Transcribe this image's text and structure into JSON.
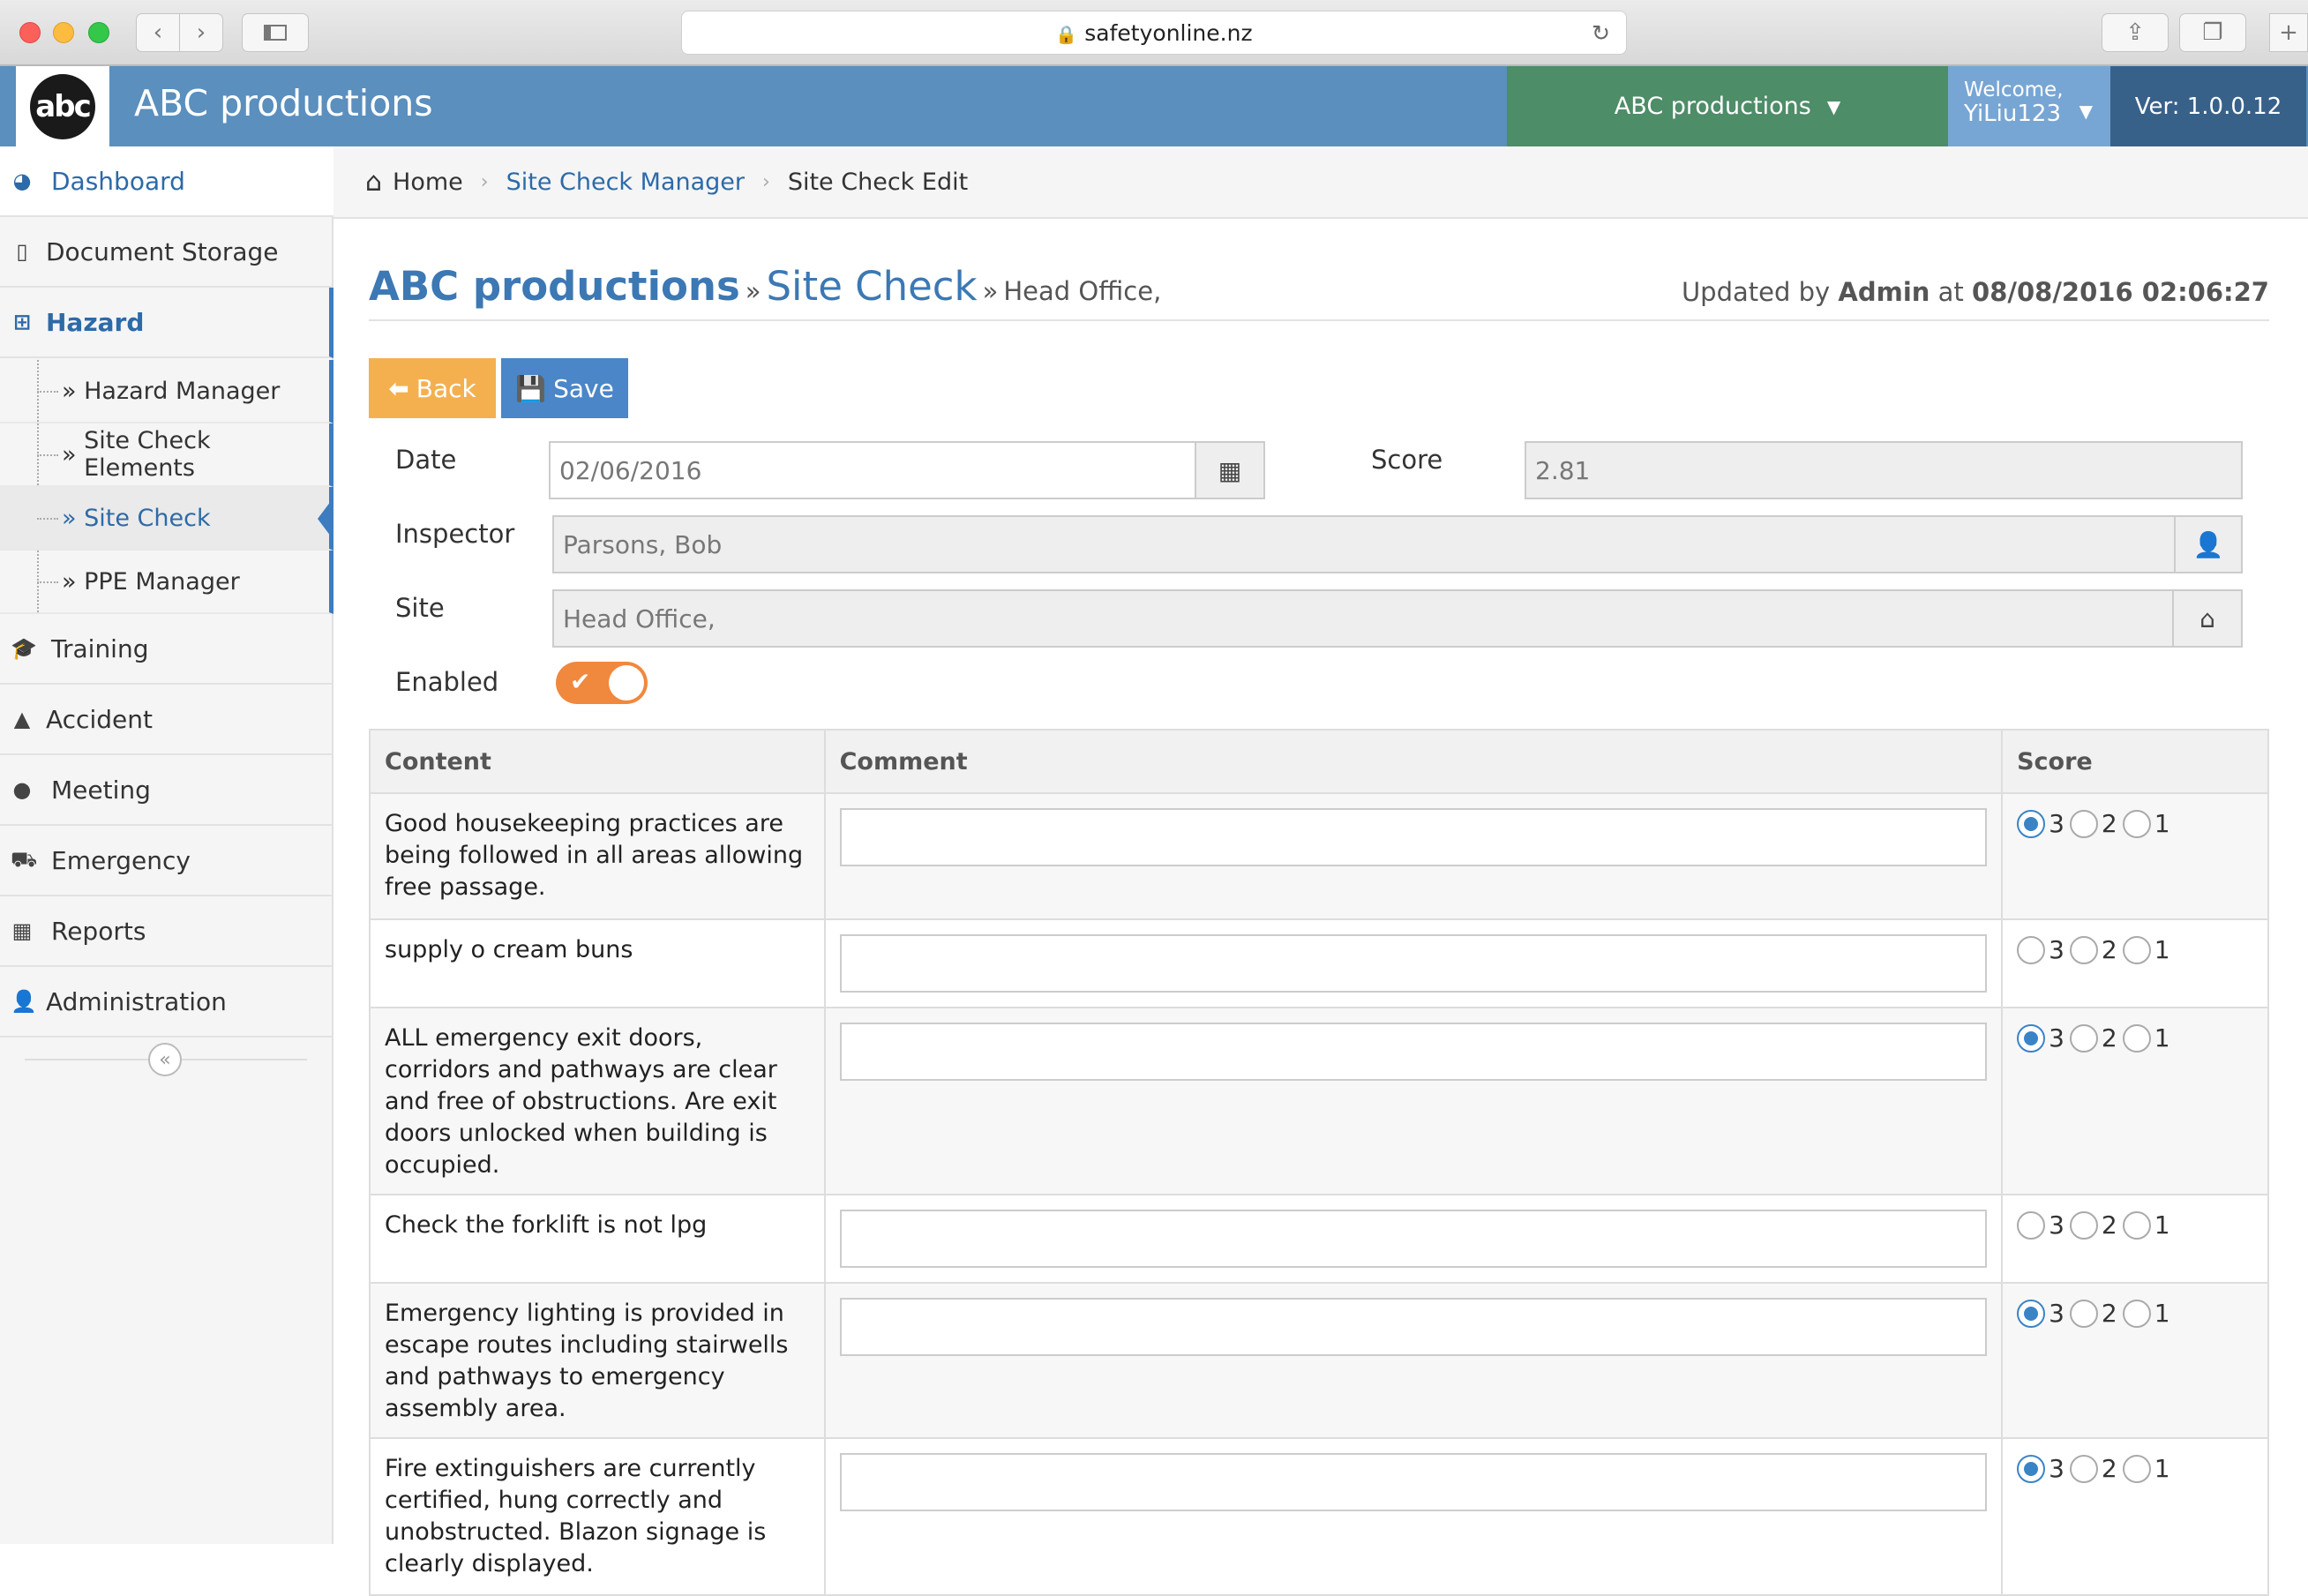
{
  "browser": {
    "url": "safetyonline.nz"
  },
  "app": {
    "title": "ABC productions",
    "logo_text": "abc",
    "org_selector": "ABC productions",
    "welcome": "Welcome,",
    "user": "YiLiu123",
    "version": "Ver: 1.0.0.12"
  },
  "sidebar": {
    "items": [
      {
        "label": "Dashboard",
        "icon": "dashboard-icon"
      },
      {
        "label": "Document Storage",
        "icon": "file-icon"
      },
      {
        "label": "Hazard",
        "icon": "hazard-icon"
      },
      {
        "label": "Training",
        "icon": "graduation-cap-icon"
      },
      {
        "label": "Accident",
        "icon": "warning-icon"
      },
      {
        "label": "Meeting",
        "icon": "comment-icon"
      },
      {
        "label": "Emergency",
        "icon": "ambulance-icon"
      },
      {
        "label": "Reports",
        "icon": "table-icon"
      },
      {
        "label": "Administration",
        "icon": "user-icon"
      }
    ],
    "sub_items": [
      "Hazard Manager",
      "Site Check Elements",
      "Site Check",
      "PPE Manager"
    ]
  },
  "breadcrumb": {
    "home": "Home",
    "manager": "Site Check Manager",
    "current": "Site Check Edit"
  },
  "page": {
    "org": "ABC productions",
    "section": "Site Check",
    "site": "Head Office,",
    "updated_prefix": "Updated by",
    "updated_by": "Admin",
    "updated_at_word": "at",
    "updated_at": "08/08/2016 02:06:27"
  },
  "actions": {
    "back": "Back",
    "save": "Save"
  },
  "form": {
    "date_label": "Date",
    "date_value": "02/06/2016",
    "score_label": "Score",
    "score_value": "2.81",
    "inspector_label": "Inspector",
    "inspector_value": "Parsons, Bob",
    "site_label": "Site",
    "site_value": "Head Office,",
    "enabled_label": "Enabled",
    "enabled": true
  },
  "table": {
    "headers": [
      "Content",
      "Comment",
      "Score"
    ],
    "score_options": [
      "3",
      "2",
      "1"
    ],
    "rows": [
      {
        "content": "Good housekeeping practices are being followed in all areas allowing free passage.",
        "comment": "",
        "score": "3"
      },
      {
        "content": "supply o cream buns",
        "comment": "",
        "score": ""
      },
      {
        "content": "ALL emergency exit doors, corridors and pathways are clear and free of obstructions. Are exit doors unlocked when building is occupied.",
        "comment": "",
        "score": "3"
      },
      {
        "content": "Check the forklift is not lpg",
        "comment": "",
        "score": ""
      },
      {
        "content": "Emergency lighting is provided in escape routes including stairwells and pathways to emergency assembly area.",
        "comment": "",
        "score": "3"
      },
      {
        "content": "Fire extinguishers are currently certified, hung correctly and unobstructed. Blazon signage is clearly displayed.",
        "comment": "",
        "score": "3"
      }
    ]
  }
}
